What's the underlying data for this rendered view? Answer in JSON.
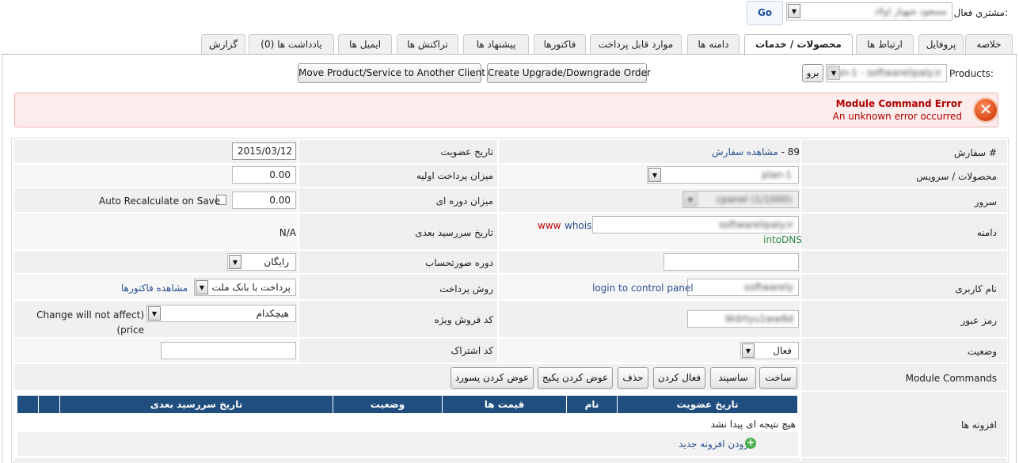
{
  "header": {
    "active_client_label": "مشتري فعال:",
    "active_client_value": "مسعود شهباز اولاد",
    "go_label": "Go"
  },
  "tabs": [
    {
      "label": "خلاصه",
      "active": false
    },
    {
      "label": "پروفایل",
      "active": false
    },
    {
      "label": "ارتباط ها",
      "active": false
    },
    {
      "label": "محصولات / خدمات",
      "active": true
    },
    {
      "label": "دامنه ها",
      "active": false
    },
    {
      "label": "موارد قابل پرداخت",
      "active": false
    },
    {
      "label": "فاکتورها",
      "active": false
    },
    {
      "label": "پیشنهاد ها",
      "active": false
    },
    {
      "label": "تراکنش ها",
      "active": false
    },
    {
      "label": "ایمیل ها",
      "active": false
    },
    {
      "label": "یادداشت ها (0)",
      "active": false
    },
    {
      "label": "گزارش",
      "active": false
    }
  ],
  "products_bar": {
    "label": "Products:",
    "selected": "plan-1 - softwarelipaly.ir",
    "go_label": "برو",
    "upgrade_button": "Create Upgrade/Downgrade Order",
    "move_button": "Move Product/Service to Another Client"
  },
  "error": {
    "title": "Module Command Error",
    "message": "An unknown error occurred"
  },
  "form": {
    "order_label": "سفارش #",
    "order_number": "89 - ",
    "order_link": "مشاهده سفارش",
    "reg_date_label": "تاریخ عضویت",
    "reg_date_value": "2015/03/12",
    "product_label": "محصولات / سرویس",
    "product_value": "plan-1",
    "first_payment_label": "میزان پرداخت اولیه",
    "first_payment_value": "0.00",
    "server_label": "سرور",
    "server_value": "cpanel (1/1000)",
    "recurring_label": "میزان دوره ای",
    "recurring_value": "0.00",
    "auto_recalc_label": "Auto Recalculate on Save",
    "domain_label": "دامنه",
    "domain_value": "softwarelipaly.ir",
    "www_link": "www",
    "whois_link": "whois",
    "intodns_link": "intoDNS",
    "next_due_label": "تاریخ سررسید بعدی",
    "next_due_value": "N/A",
    "billing_cycle_label": "دوره صورتحساب",
    "billing_cycle_value": "رایگان",
    "username_label": "نام کاربری",
    "username_value": "softwarely",
    "login_link": "login to control panel",
    "payment_method_label": "روش پرداخت",
    "payment_method_value": "پرداخت با بانک ملت",
    "view_invoices_link": "مشاهده فاکتورها",
    "password_label": "رمز عبور",
    "password_value": "Wdrtyu1ww8d",
    "promo_label": "کد فروش ویژه",
    "promo_value": "هیچکدام",
    "promo_note": "(Change will not affect price)",
    "status_label": "وضعیت",
    "status_value": "فعال",
    "subscription_label": "کد اشتراک",
    "subscription_value": ""
  },
  "module_commands": {
    "label": "Module Commands",
    "buttons": [
      "ساخت",
      "ساسپند",
      "فعال کردن",
      "حذف",
      "عوض کردن پکیج",
      "عوض کردن پسورد"
    ]
  },
  "addons": {
    "label": "افزونه ها",
    "columns": [
      "تاریخ عضویت",
      "نام",
      "قیمت ها",
      "وضعیت",
      "تاریخ سررسید بعدی",
      "",
      ""
    ],
    "empty_text": "هیچ نتیجه ای پیدا نشد",
    "add_link": "افزودن افزونه جدید"
  },
  "colors": {
    "error_red": "#b30000",
    "link_blue": "#2a4f8f",
    "table_header": "#1f4e7f",
    "www_red": "#c00000"
  }
}
